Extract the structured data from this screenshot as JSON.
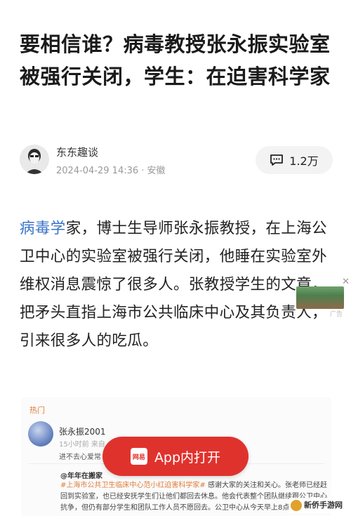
{
  "article": {
    "title": "要相信谁？病毒教授张永振实验室被强行关闭，学生：在迫害科学家",
    "author": {
      "name": "东东趣谈",
      "meta": "2024-04-29 14:36 · 安徽"
    },
    "comment_count": "1.2万",
    "body_link": "病毒学",
    "body_rest": "家，博士生导师张永振教授，在上海公卫中心的实验室被强行关闭，他睡在实验室外维权消息震惊了很多人。张教授学生的文章，把矛头直指上海市公共临床中心及其负责人，引来很多人的吃瓜。"
  },
  "embed": {
    "hot_label": "热门",
    "name": "张永振2001",
    "time": "15小时前 来自",
    "line1": "进不去心爱常",
    "sub": "@年年在搬家",
    "tag": "#上海市公共卫生临床中心范小红迫害科学家#",
    "para": "感谢大家的关注和关心。张老师已经赶回到实验室，也已经安抚学生们让他们都回去休息。他会代表整个团队继续跟公卫中心抗争，但仍有部分学生和团队工作人员不愿回去。公卫中心从今天早上8点不…"
  },
  "ad": {
    "close": "✕",
    "label": "广告"
  },
  "app_button": {
    "logo": "网易",
    "label": "App内打开"
  },
  "watermark": "新侨手游网",
  "colors": {
    "link": "#3a73c9",
    "app_red": "#e0322d",
    "hot_orange": "#e07b39"
  }
}
